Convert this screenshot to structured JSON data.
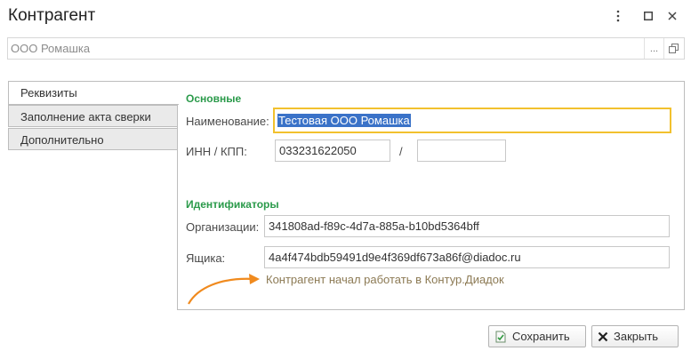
{
  "window": {
    "title": "Контрагент",
    "more_icon": "more-vertical-icon",
    "maximize_icon": "maximize-icon",
    "close_icon": "close-icon"
  },
  "ref_field": {
    "value": "ООО Ромашка",
    "select_label": "...",
    "open_icon": "open-link-icon"
  },
  "tabs": [
    {
      "label": "Реквизиты",
      "active": true
    },
    {
      "label": "Заполнение акта сверки",
      "active": false
    },
    {
      "label": "Дополнительно",
      "active": false
    }
  ],
  "main": {
    "section_main": "Основные",
    "name_label": "Наименование:",
    "name_value": "Тестовая ООО Ромашка",
    "inn_label": "ИНН / КПП:",
    "inn_value": "033231622050",
    "kpp_separator": "/",
    "kpp_value": "",
    "section_ids": "Идентификаторы",
    "org_label": "Организации:",
    "org_value": "341808ad-f89c-4d7a-885a-b10bd5364bff",
    "box_label": "Ящика:",
    "box_value": "4a4f474bdb59491d9e4f369df673a86f@diadoc.ru",
    "note": "Контрагент начал работать в Контур.Диадок"
  },
  "footer": {
    "save_label": "Сохранить",
    "close_label": "Закрыть"
  },
  "colors": {
    "section_title": "#2a9a4a",
    "focus_border": "#f2c12e",
    "selection": "#3a72c8",
    "arrow": "#f08a1e",
    "note": "#8c7a54"
  }
}
